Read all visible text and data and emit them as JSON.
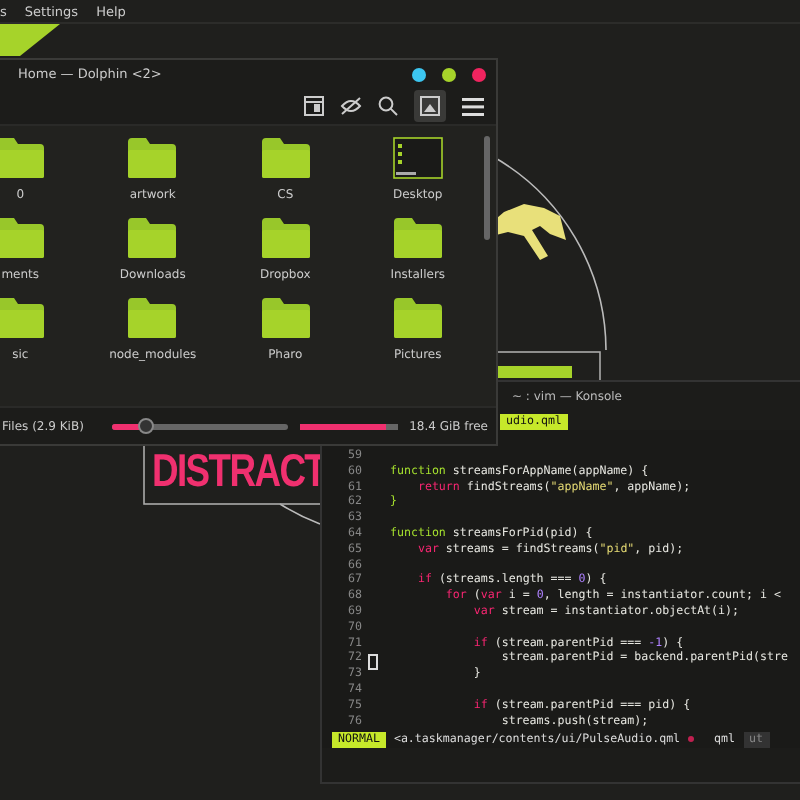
{
  "menu_bar": {
    "items": [
      "s",
      "Settings",
      "Help"
    ]
  },
  "wallpaper": {
    "text": "DISTRACT"
  },
  "dolphin": {
    "title": "Home — Dolphin <2>",
    "items": [
      {
        "label": "0",
        "kind": "folder"
      },
      {
        "label": "artwork",
        "kind": "folder"
      },
      {
        "label": "CS",
        "kind": "folder"
      },
      {
        "label": "Desktop",
        "kind": "desktop"
      },
      {
        "label": "ments",
        "kind": "folder"
      },
      {
        "label": "Downloads",
        "kind": "folder"
      },
      {
        "label": "Dropbox",
        "kind": "folder"
      },
      {
        "label": "Installers",
        "kind": "folder"
      },
      {
        "label": "sic",
        "kind": "folder"
      },
      {
        "label": "node_modules",
        "kind": "folder"
      },
      {
        "label": "Pharo",
        "kind": "folder"
      },
      {
        "label": "Pictures",
        "kind": "folder"
      }
    ],
    "status": {
      "files": "Files (2.9 KiB)",
      "zoom": {
        "level": 0.2
      },
      "storage": {
        "level": 0.88
      },
      "free": "18.4 GiB free"
    }
  },
  "konsole": {
    "title": "~ : vim — Konsole",
    "tab": "udio.qml",
    "lines": [
      {
        "number": "59"
      },
      {
        "number": "60",
        "segments": [
          {
            "kind": "fn",
            "text": "function"
          },
          {
            "kind": "plain",
            "text": " streamsForAppName(appName) {"
          }
        ]
      },
      {
        "number": "61",
        "segments": [
          {
            "kind": "kw",
            "text": "    return"
          },
          {
            "kind": "plain",
            "text": " findStreams("
          },
          {
            "kind": "str",
            "text": "\"appName\""
          },
          {
            "kind": "plain",
            "text": ", appName);"
          }
        ]
      },
      {
        "number": "62",
        "segments": [
          {
            "kind": "fn",
            "text": "}"
          }
        ]
      },
      {
        "number": "63"
      },
      {
        "number": "64",
        "segments": [
          {
            "kind": "fn",
            "text": "function"
          },
          {
            "kind": "plain",
            "text": " streamsForPid(pid) {"
          }
        ]
      },
      {
        "number": "65",
        "segments": [
          {
            "kind": "kw",
            "text": "    var"
          },
          {
            "kind": "plain",
            "text": " streams = findStreams("
          },
          {
            "kind": "str",
            "text": "\"pid\""
          },
          {
            "kind": "plain",
            "text": ", pid);"
          }
        ]
      },
      {
        "number": "66"
      },
      {
        "number": "67",
        "segments": [
          {
            "kind": "kw",
            "text": "    if"
          },
          {
            "kind": "plain",
            "text": " (streams.length === "
          },
          {
            "kind": "num",
            "text": "0"
          },
          {
            "kind": "plain",
            "text": ") {"
          }
        ]
      },
      {
        "number": "68",
        "segments": [
          {
            "kind": "kw",
            "text": "        for"
          },
          {
            "kind": "plain",
            "text": " ("
          },
          {
            "kind": "kw",
            "text": "var"
          },
          {
            "kind": "plain",
            "text": " i = "
          },
          {
            "kind": "num",
            "text": "0"
          },
          {
            "kind": "plain",
            "text": ", length = instantiator.count; i <"
          }
        ]
      },
      {
        "number": "69",
        "segments": [
          {
            "kind": "kw",
            "text": "            var"
          },
          {
            "kind": "plain",
            "text": " stream = instantiator.objectAt(i);"
          }
        ]
      },
      {
        "number": "70"
      },
      {
        "number": "71",
        "segments": [
          {
            "kind": "kw",
            "text": "            if"
          },
          {
            "kind": "plain",
            "text": " (stream.parentPid === "
          },
          {
            "kind": "num",
            "text": "-1"
          },
          {
            "kind": "plain",
            "text": ") {"
          }
        ]
      },
      {
        "number": "72",
        "segments": [
          {
            "kind": "plain",
            "text": "                stream.parentPid = backend.parentPid(stre"
          }
        ]
      },
      {
        "number": "73",
        "segments": [
          {
            "kind": "plain",
            "text": "            }"
          }
        ]
      },
      {
        "number": "74"
      },
      {
        "number": "75",
        "segments": [
          {
            "kind": "kw",
            "text": "            if"
          },
          {
            "kind": "plain",
            "text": " (stream.parentPid === pid) {"
          }
        ]
      },
      {
        "number": "76",
        "segments": [
          {
            "kind": "plain",
            "text": "                streams.push(stream);"
          }
        ]
      }
    ],
    "statusline": {
      "mode": "NORMAL",
      "path": "<a.taskmanager/contents/ui/PulseAudio.qml",
      "filetype": "qml",
      "encoding": "ut"
    }
  }
}
